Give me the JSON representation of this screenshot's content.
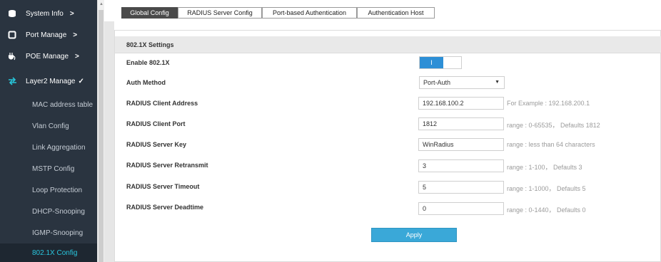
{
  "sidebar": {
    "top_items": [
      {
        "label": "System Info",
        "icon": "database-icon"
      },
      {
        "label": "Port Manage",
        "icon": "square-icon"
      },
      {
        "label": "POE Manage",
        "icon": "plug-icon"
      },
      {
        "label": "Layer2 Manage",
        "icon": "exchange-icon"
      }
    ],
    "sub_items": [
      "MAC address table",
      "Vlan Config",
      "Link Aggregation",
      "MSTP Config",
      "Loop Protection",
      "DHCP-Snooping",
      "IGMP-Snooping",
      "802.1X Config"
    ]
  },
  "tabs": [
    "Global Config",
    "RADIUS Server Config",
    "Port-based Authentication",
    "Authentication Host"
  ],
  "section": {
    "title": "802.1X Settings",
    "rows": {
      "enable": {
        "label": "Enable 802.1X",
        "toggle_text": "I"
      },
      "auth_method": {
        "label": "Auth Method",
        "value": "Port-Auth"
      },
      "client_address": {
        "label": "RADIUS Client Address",
        "value": "192.168.100.2",
        "hint": "For Example : 192.168.200.1"
      },
      "client_port": {
        "label": "RADIUS Client Port",
        "value": "1812",
        "hint": "range : 0-65535， Defaults 1812"
      },
      "server_key": {
        "label": "RADIUS Server Key",
        "value": "WinRadius",
        "hint": "range : less than 64 characters"
      },
      "retransmit": {
        "label": "RADIUS Server Retransmit",
        "value": "3",
        "hint": "range : 1-100， Defaults 3"
      },
      "timeout": {
        "label": "RADIUS Server Timeout",
        "value": "5",
        "hint": "range : 1-1000， Defaults 5"
      },
      "deadtime": {
        "label": "RADIUS Server Deadtime",
        "value": "0",
        "hint": "range : 0-1440， Defaults 0"
      }
    }
  },
  "apply_label": "Apply",
  "colors": {
    "sidebar": "#2a3440",
    "accent": "#29c6de",
    "toggle_on": "#2d8fd6",
    "apply": "#3aa8d8"
  }
}
